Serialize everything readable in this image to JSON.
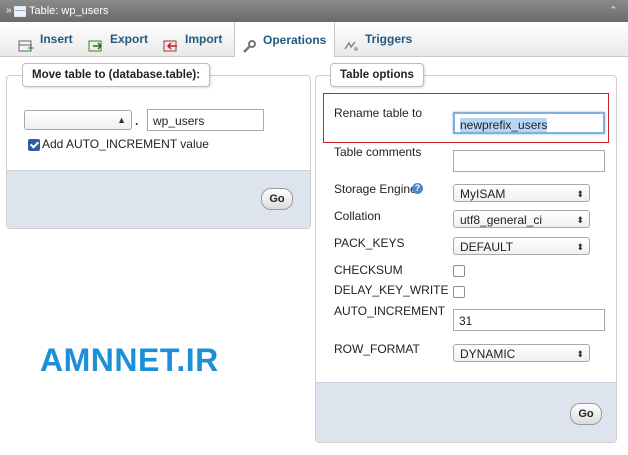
{
  "titlebar": {
    "lead": "»",
    "title": "Table: wp_users",
    "collapse_icon": "collapse-arrow-icon"
  },
  "tabs": [
    {
      "label": "Insert",
      "icon": "insert-icon"
    },
    {
      "label": "Export",
      "icon": "export-icon"
    },
    {
      "label": "Import",
      "icon": "import-icon"
    },
    {
      "label": "Operations",
      "icon": "wrench-icon",
      "active": true
    },
    {
      "label": "Triggers",
      "icon": "triggers-icon"
    }
  ],
  "move_table": {
    "legend": "Move table to (database.table):",
    "db_select_value": "",
    "dot": ".",
    "table_name_value": "wp_users",
    "auto_increment_label": "Add AUTO_INCREMENT value",
    "auto_increment_checked": true,
    "go_label": "Go"
  },
  "table_options": {
    "legend": "Table options",
    "rename_label": "Rename table to",
    "rename_value": "newprefix_users",
    "comments_label": "Table comments",
    "comments_value": "",
    "storage_engine_label": "Storage Engine",
    "storage_engine_value": "MyISAM",
    "collation_label": "Collation",
    "collation_value": "utf8_general_ci",
    "pack_keys_label": "PACK_KEYS",
    "pack_keys_value": "DEFAULT",
    "checksum_label": "CHECKSUM",
    "delay_key_write_label": "DELAY_KEY_WRITE",
    "auto_increment_label": "AUTO_INCREMENT",
    "auto_increment_value": "31",
    "row_format_label": "ROW_FORMAT",
    "row_format_value": "DYNAMIC",
    "go_label": "Go",
    "highlight_color": "#cc2222"
  },
  "watermark": "AMNNET.IR"
}
